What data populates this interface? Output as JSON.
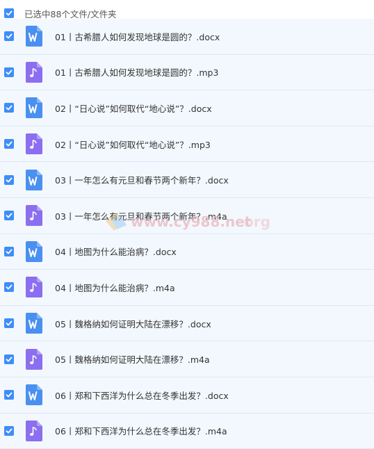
{
  "header": {
    "selection_text": "已选中88个文件/文件夹"
  },
  "colors": {
    "checkbox": "#3e8ef7",
    "doc_icon": "#4a90f0",
    "audio_icon": "#8b6ff0",
    "row_bg": "#f3f8fe"
  },
  "files": [
    {
      "type": "doc",
      "icon": "word-doc-icon",
      "name": "01丨古希腊人如何发现地球是圆的？.docx"
    },
    {
      "type": "audio",
      "icon": "audio-file-icon",
      "name": "01丨古希腊人如何发现地球是圆的？.mp3"
    },
    {
      "type": "doc",
      "icon": "word-doc-icon",
      "name": "02丨“日心说”如何取代“地心说”？.docx"
    },
    {
      "type": "audio",
      "icon": "audio-file-icon",
      "name": "02丨“日心说”如何取代“地心说”？.mp3"
    },
    {
      "type": "doc",
      "icon": "word-doc-icon",
      "name": "03丨一年怎么有元旦和春节两个新年？.docx"
    },
    {
      "type": "audio",
      "icon": "audio-file-icon",
      "name": "03丨一年怎么有元旦和春节两个新年？.m4a"
    },
    {
      "type": "doc",
      "icon": "word-doc-icon",
      "name": "04丨地图为什么能治病？.docx"
    },
    {
      "type": "audio",
      "icon": "audio-file-icon",
      "name": "04丨地图为什么能治病？.m4a"
    },
    {
      "type": "doc",
      "icon": "word-doc-icon",
      "name": "05丨魏格纳如何证明大陆在漂移？.docx"
    },
    {
      "type": "audio",
      "icon": "audio-file-icon",
      "name": "05丨魏格纳如何证明大陆在漂移？.m4a"
    },
    {
      "type": "doc",
      "icon": "word-doc-icon",
      "name": "06丨郑和下西洋为什么总在冬季出发？.docx"
    },
    {
      "type": "audio",
      "icon": "audio-file-icon",
      "name": "06丨郑和下西洋为什么总在冬季出发？.m4a"
    }
  ],
  "watermark": {
    "text": "www.cy988.net",
    "suffix": "org"
  }
}
